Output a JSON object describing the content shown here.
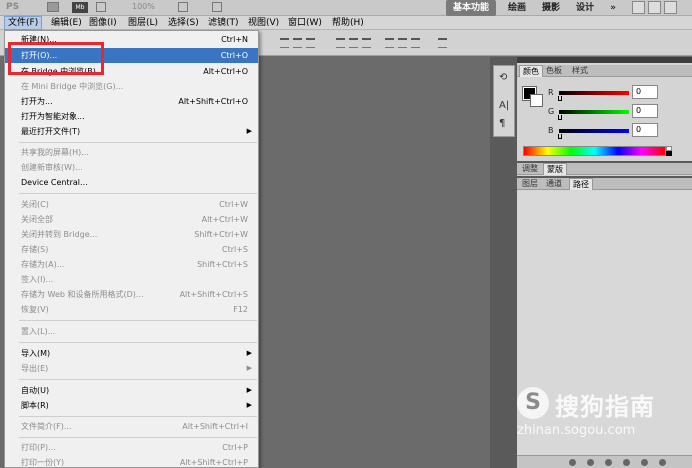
{
  "appbar": {
    "logo": "PS",
    "bridge_label": "Mb",
    "zoom": "100%",
    "workspaces": [
      "基本功能",
      "绘画",
      "摄影",
      "设计"
    ],
    "more": "»"
  },
  "menubar": {
    "items": [
      "文件(F)",
      "编辑(E)",
      "图像(I)",
      "图层(L)",
      "选择(S)",
      "滤镜(T)",
      "视图(V)",
      "窗口(W)",
      "帮助(H)"
    ]
  },
  "file_menu": {
    "items": [
      {
        "label": "新建(N)...",
        "shortcut": "Ctrl+N"
      },
      {
        "label": "打开(O)...",
        "shortcut": "Ctrl+O"
      },
      {
        "label": "在 Bridge 中浏览(B)...",
        "shortcut": "Alt+Ctrl+O"
      },
      {
        "label": "在 Mini Bridge 中浏览(G)...",
        "shortcut": ""
      },
      {
        "label": "打开为...",
        "shortcut": "Alt+Shift+Ctrl+O"
      },
      {
        "label": "打开为智能对象...",
        "shortcut": ""
      },
      {
        "label": "最近打开文件(T)",
        "shortcut": ""
      },
      {
        "label": "共享我的屏幕(H)...",
        "shortcut": ""
      },
      {
        "label": "创建新审核(W)...",
        "shortcut": ""
      },
      {
        "label": "Device Central...",
        "shortcut": ""
      },
      {
        "label": "关闭(C)",
        "shortcut": "Ctrl+W"
      },
      {
        "label": "关闭全部",
        "shortcut": "Alt+Ctrl+W"
      },
      {
        "label": "关闭并转到 Bridge...",
        "shortcut": "Shift+Ctrl+W"
      },
      {
        "label": "存储(S)",
        "shortcut": "Ctrl+S"
      },
      {
        "label": "存储为(A)...",
        "shortcut": "Shift+Ctrl+S"
      },
      {
        "label": "签入(I)...",
        "shortcut": ""
      },
      {
        "label": "存储为 Web 和设备所用格式(D)...",
        "shortcut": "Alt+Shift+Ctrl+S"
      },
      {
        "label": "恢复(V)",
        "shortcut": "F12"
      },
      {
        "label": "置入(L)...",
        "shortcut": ""
      },
      {
        "label": "导入(M)",
        "shortcut": ""
      },
      {
        "label": "导出(E)",
        "shortcut": ""
      },
      {
        "label": "自动(U)",
        "shortcut": ""
      },
      {
        "label": "脚本(R)",
        "shortcut": ""
      },
      {
        "label": "文件简介(F)...",
        "shortcut": "Alt+Shift+Ctrl+I"
      },
      {
        "label": "打印(P)...",
        "shortcut": "Ctrl+P"
      },
      {
        "label": "打印一份(Y)",
        "shortcut": "Alt+Shift+Ctrl+P"
      }
    ]
  },
  "color_panel": {
    "tabs": [
      "颜色",
      "色板",
      "样式"
    ],
    "channels": [
      {
        "label": "R",
        "value": "0"
      },
      {
        "label": "G",
        "value": "0"
      },
      {
        "label": "B",
        "value": "0"
      }
    ],
    "foreground": "#000000",
    "background": "#ffffff"
  },
  "adjust_panel": {
    "tabs": [
      "调整",
      "蒙版"
    ]
  },
  "layers_panel": {
    "tabs": [
      "图层",
      "通道",
      "路径"
    ]
  },
  "watermark": {
    "title": "搜狗指南",
    "url": "zhinan.sogou.com",
    "mark": "S"
  }
}
